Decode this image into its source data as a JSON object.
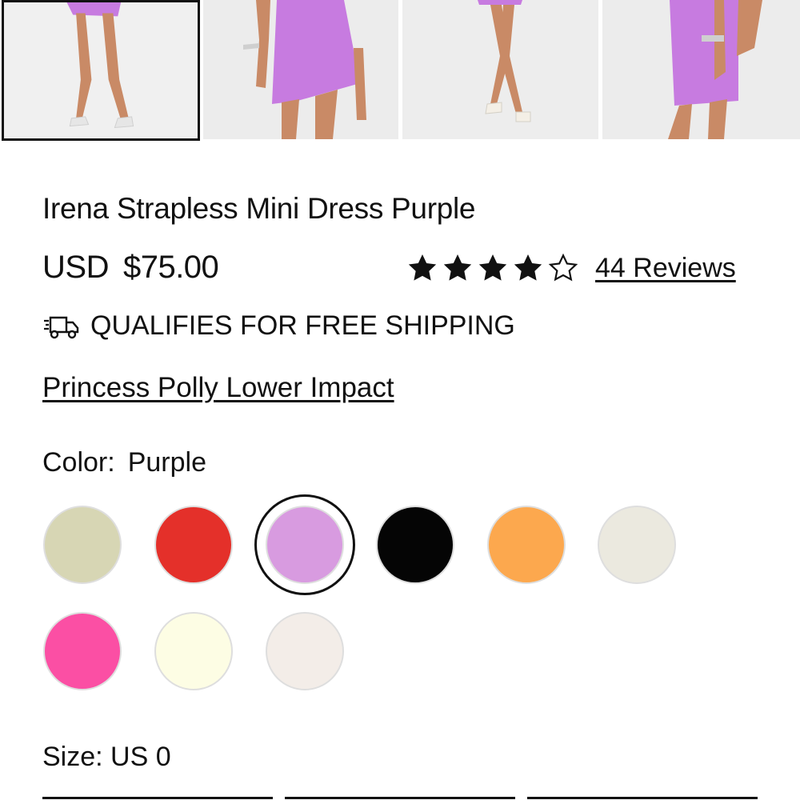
{
  "gallery": {
    "thumbnails": [
      {
        "alt": "Front view legs",
        "selected": true
      },
      {
        "alt": "Side view dress"
      },
      {
        "alt": "Front view crossed legs"
      },
      {
        "alt": "Side view close up"
      }
    ],
    "dress_color": "#c77be0"
  },
  "product": {
    "title": "Irena Strapless Mini Dress Purple",
    "currency": "USD",
    "price": "$75.00",
    "rating": 4,
    "rating_max": 5,
    "reviews_label": "44 Reviews",
    "shipping_label": "QUALIFIES FOR FREE SHIPPING",
    "impact_link": "Princess Polly Lower Impact",
    "color_label": "Color:",
    "color_value": "Purple",
    "size_label": "Size: US 0"
  },
  "swatches": [
    {
      "name": "sage",
      "color": "#d7d6b4"
    },
    {
      "name": "red",
      "color": "#e4302a"
    },
    {
      "name": "purple",
      "color": "#d89be0",
      "selected": true
    },
    {
      "name": "black",
      "color": "#050505"
    },
    {
      "name": "orange",
      "color": "#fca84e"
    },
    {
      "name": "cream",
      "color": "#ebe9df"
    },
    {
      "name": "hot-pink",
      "color": "#fb4fa4"
    },
    {
      "name": "light-yellow",
      "color": "#fdfde4"
    },
    {
      "name": "off-white",
      "color": "#f3ede8"
    }
  ],
  "icons": {
    "star_filled": "star-filled-icon",
    "star_empty": "star-outline-icon",
    "shipping": "truck-icon"
  }
}
